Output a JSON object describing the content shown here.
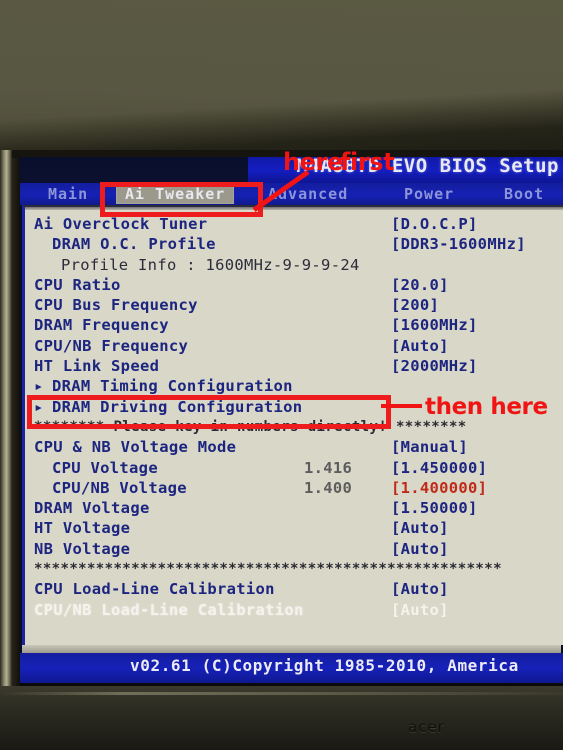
{
  "photo": {
    "device_brand": "acer"
  },
  "bios": {
    "title": "M4A88TD EVO BIOS Setup",
    "menu": [
      {
        "id": "main",
        "label": "Main",
        "selected": false
      },
      {
        "id": "tweaker",
        "label": "Ai Tweaker",
        "selected": true
      },
      {
        "id": "advanced",
        "label": "Advanced",
        "selected": false
      },
      {
        "id": "power",
        "label": "Power",
        "selected": false
      },
      {
        "id": "boot",
        "label": "Boot",
        "selected": false
      }
    ],
    "rows": [
      {
        "kind": "setting",
        "label": "Ai Overclock Tuner",
        "value": "[D.O.C.P]"
      },
      {
        "kind": "setting",
        "label": "DRAM O.C. Profile",
        "value": "[DDR3-1600MHz]",
        "indent": 1
      },
      {
        "kind": "info",
        "label": "Profile Info : 1600MHz-9-9-9-24"
      },
      {
        "kind": "setting",
        "label": "CPU Ratio",
        "value": "[20.0]"
      },
      {
        "kind": "setting",
        "label": "CPU Bus Frequency",
        "value": "[200]"
      },
      {
        "kind": "setting",
        "label": "DRAM Frequency",
        "value": "[1600MHz]"
      },
      {
        "kind": "setting",
        "label": "CPU/NB Frequency",
        "value": "[Auto]"
      },
      {
        "kind": "setting",
        "label": "HT Link Speed",
        "value": "[2000MHz]"
      },
      {
        "kind": "submenu",
        "label": "DRAM Timing Configuration"
      },
      {
        "kind": "submenu",
        "label": "DRAM Driving Configuration"
      },
      {
        "kind": "banner",
        "label": "******** Please key in numbers directly! ********"
      },
      {
        "kind": "setting",
        "label": "CPU & NB Voltage Mode",
        "value": "[Manual]"
      },
      {
        "kind": "setting",
        "label": "CPU Voltage",
        "value": "[1.450000]",
        "current": "1.416",
        "indent": 1
      },
      {
        "kind": "setting",
        "label": "CPU/NB Voltage",
        "value": "[1.400000]",
        "current": "1.400",
        "indent": 1,
        "value_color": "red"
      },
      {
        "kind": "setting",
        "label": "DRAM Voltage",
        "value": "[1.50000]"
      },
      {
        "kind": "setting",
        "label": "HT Voltage",
        "value": "[Auto]"
      },
      {
        "kind": "setting",
        "label": "NB Voltage",
        "value": "[Auto]"
      },
      {
        "kind": "divider",
        "label": "*****************************************************"
      },
      {
        "kind": "setting",
        "label": "CPU Load-Line Calibration",
        "value": "[Auto]"
      },
      {
        "kind": "setting",
        "label": "CPU/NB Load-Line Calibration",
        "value": "[Auto]",
        "selected": true
      }
    ],
    "status": "v02.61 (C)Copyright 1985-2010, America"
  },
  "annotations": {
    "here": "here",
    "first": "first",
    "then_here": "then here",
    "marker_color": "#f01414"
  }
}
